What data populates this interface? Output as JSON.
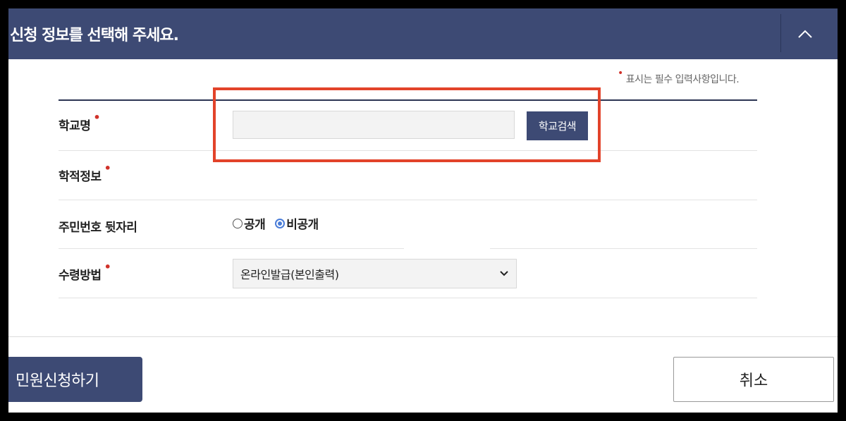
{
  "header": {
    "title": "신청 정보를 선택해 주세요.",
    "collapse_icon": "chevron-up-icon"
  },
  "required_note": {
    "marker": "•",
    "text": "표시는 필수 입력사항입니다."
  },
  "form": {
    "school": {
      "label": "학교명",
      "required": true,
      "input_value": "",
      "input_placeholder": "",
      "search_button": "학교검색"
    },
    "academic_info": {
      "label": "학적정보",
      "required": true
    },
    "resident_number": {
      "label": "주민번호 뒷자리",
      "options": [
        {
          "label": "공개",
          "checked": false
        },
        {
          "label": "비공개",
          "checked": true
        }
      ]
    },
    "receipt_method": {
      "label": "수령방법",
      "required": true,
      "selected": "온라인발급(본인출력)"
    }
  },
  "footer": {
    "submit_button": "민원신청하기",
    "cancel_button": "취소"
  },
  "colors": {
    "header_bg": "#3d4a74",
    "highlight": "#e2432a",
    "required_dot": "#d0322a",
    "radio_checked": "#4a7dd8"
  }
}
